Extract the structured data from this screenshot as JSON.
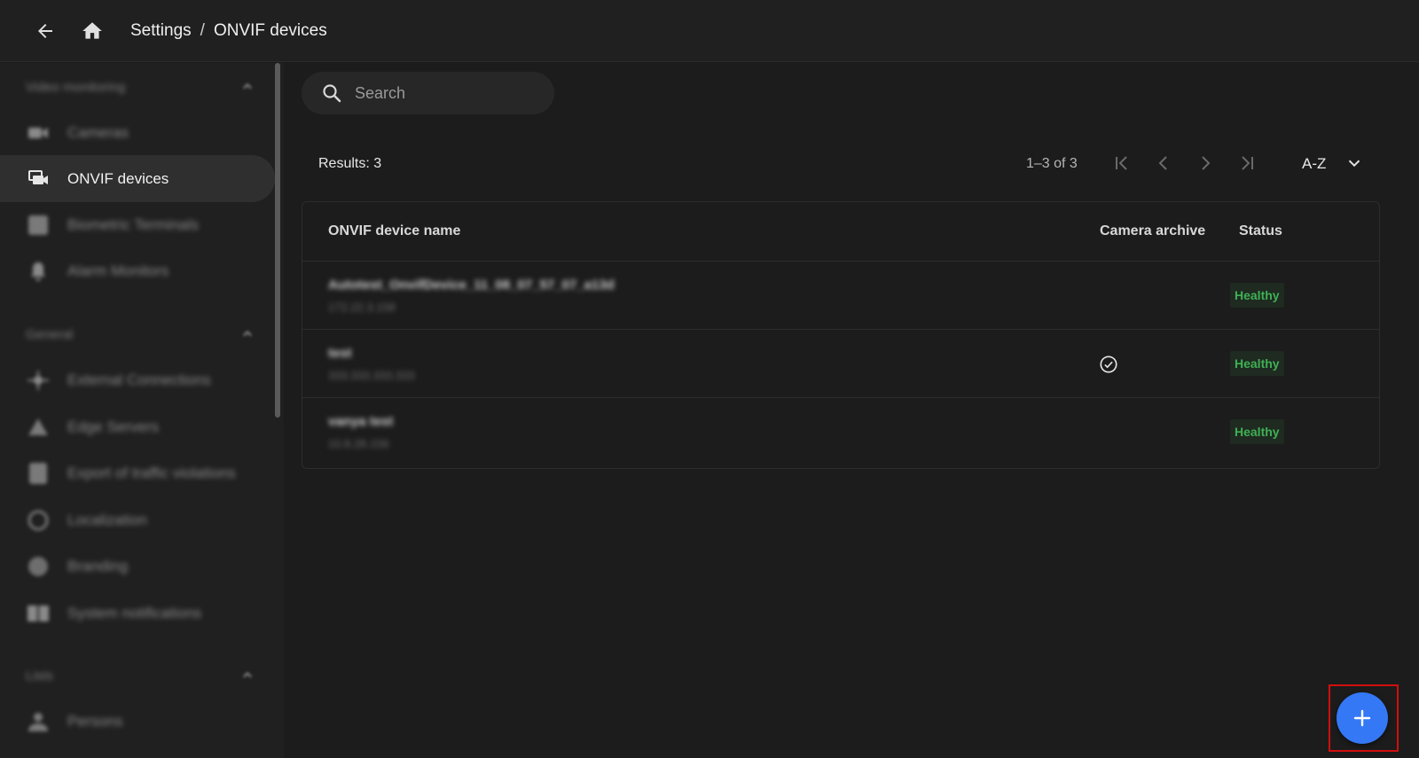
{
  "header": {
    "breadcrumb_root": "Settings",
    "breadcrumb_sep": "/",
    "breadcrumb_current": "ONVIF devices"
  },
  "sidebar": {
    "sections": [
      {
        "title": "Video monitoring"
      },
      {
        "title": "General"
      },
      {
        "title": "Lists"
      }
    ],
    "items": [
      {
        "label": "Cameras",
        "icon": "camera-icon"
      },
      {
        "label": "ONVIF devices",
        "icon": "onvif-devices-icon",
        "active": true
      },
      {
        "label": "Biometric Terminals",
        "icon": "terminal-icon"
      },
      {
        "label": "Alarm Monitors",
        "icon": "alarm-icon"
      },
      {
        "label": "External Connections",
        "icon": "connection-icon"
      },
      {
        "label": "Edge Servers",
        "icon": "server-icon"
      },
      {
        "label": "Export of traffic violations",
        "icon": "export-icon"
      },
      {
        "label": "Localization",
        "icon": "globe-icon"
      },
      {
        "label": "Branding",
        "icon": "branding-icon"
      },
      {
        "label": "System notifications",
        "icon": "notification-icon"
      },
      {
        "label": "Persons",
        "icon": "persons-icon"
      }
    ]
  },
  "search": {
    "placeholder": "Search"
  },
  "toolbar": {
    "results": "Results: 3",
    "range": "1–3 of 3",
    "sort": "A-Z"
  },
  "table": {
    "columns": [
      "ONVIF device name",
      "Camera archive",
      "Status"
    ],
    "rows": [
      {
        "name": "Autotest_OnvifDevice_11_08_07_57_07_a13d",
        "address": "172.22.3.158",
        "archive": false,
        "status": "Healthy"
      },
      {
        "name": "test",
        "address": "333.333.333.333",
        "archive": true,
        "status": "Healthy"
      },
      {
        "name": "vanya test",
        "address": "10.8.28.156",
        "archive": false,
        "status": "Healthy"
      }
    ]
  },
  "colors": {
    "accent": "#3478f6",
    "status_healthy": "#3fb054",
    "highlight_outline": "#d10f0f"
  }
}
